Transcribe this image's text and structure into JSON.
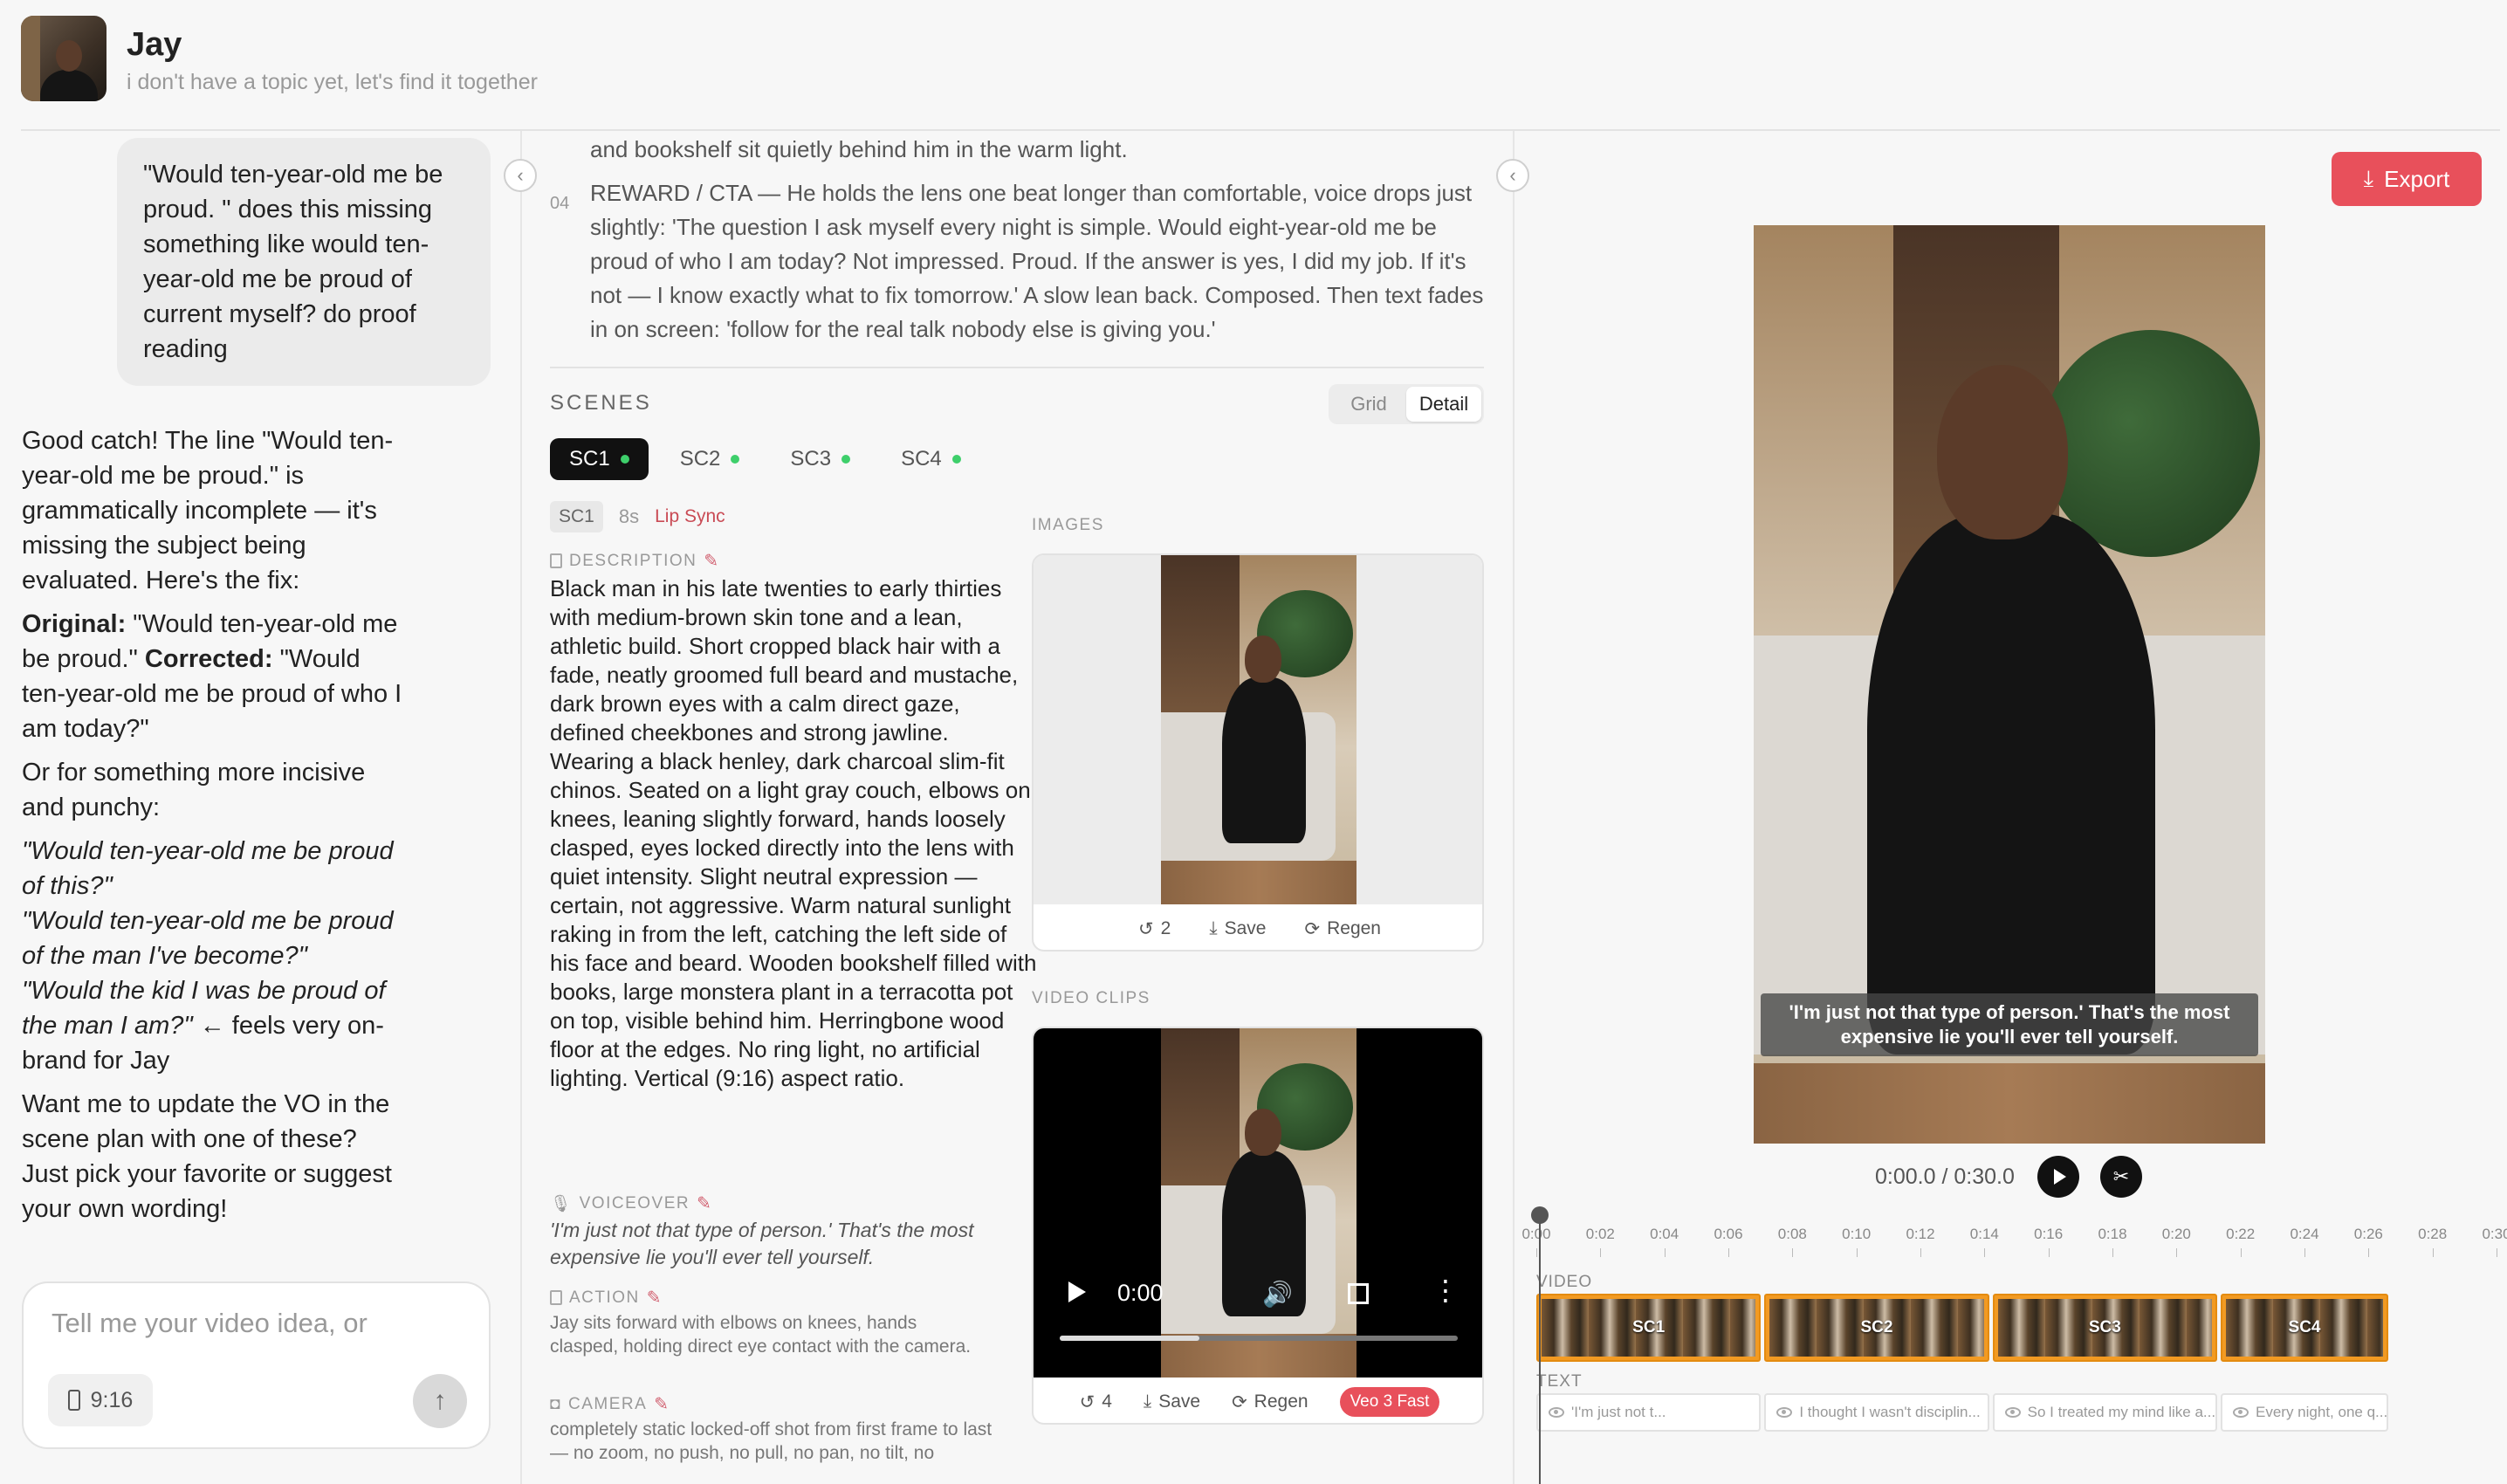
{
  "user": {
    "name": "Jay",
    "topic": "i don't have a topic yet, let's find it together"
  },
  "chat": {
    "user_message": "\"Would ten-year-old me be proud. \" does this missing something like would ten-year-old me be proud of current myself? do proof reading",
    "reply": {
      "p1": "Good catch! The line \"Would ten-year-old me be proud.\" is grammatically incomplete — it's missing the subject being evaluated. Here's the fix:",
      "original_label": "Original:",
      "original_text": " \"Would ten-year-old me be proud.\" ",
      "corrected_label": "Corrected:",
      "corrected_text": " \"Would ten-year-old me be proud of who I am today?\"",
      "p3": "Or for something more incisive and punchy:",
      "opt1": "\"Would ten-year-old me be proud of this?\"",
      "opt2": "\"Would ten-year-old me be proud of the man I've become?\"",
      "opt3_italic": "\"Would the kid I was be proud of the man I am?\"",
      "opt3_note": " ← feels very on-brand for Jay",
      "p5": "Want me to update the VO in the scene plan with one of these? Just pick your favorite or suggest your own wording!"
    },
    "composer": {
      "placeholder": "Tell me your video idea, or",
      "ratio": "9:16"
    }
  },
  "script": {
    "prev_line": "and bookshelf sit quietly behind him in the warm light.",
    "beat_num": "04",
    "beat_text": "REWARD / CTA — He holds the lens one beat longer than comfortable, voice drops just slightly: 'The question I ask myself every night is simple. Would eight-year-old me be proud of who I am today? Not impressed. Proud. If the answer is yes, I did my job. If it's not — I know exactly what to fix tomorrow.' A slow lean back. Composed. Then text fades in on screen: 'follow for the real talk nobody else is giving you.'"
  },
  "scenes": {
    "label": "SCENES",
    "view_grid": "Grid",
    "view_detail": "Detail",
    "tabs": [
      "SC1",
      "SC2",
      "SC3",
      "SC4"
    ],
    "active": {
      "id": "SC1",
      "duration": "8s",
      "mode": "Lip Sync",
      "description_label": "DESCRIPTION",
      "description": "Black man in his late twenties to early thirties with medium-brown skin tone and a lean, athletic build. Short cropped black hair with a fade, neatly groomed full beard and mustache, dark brown eyes with a calm direct gaze, defined cheekbones and strong jawline. Wearing a black henley, dark charcoal slim-fit chinos. Seated on a light gray couch, elbows on knees, leaning slightly forward, hands loosely clasped, eyes locked directly into the lens with quiet intensity. Slight neutral expression — certain, not aggressive. Warm natural sunlight raking in from the left, catching the left side of his face and beard. Wooden bookshelf filled with books, large monstera plant in a terracotta pot on top, visible behind him. Herringbone wood floor at the edges. No ring light, no artificial lighting. Vertical (9:16) aspect ratio.",
      "voiceover_label": "VOICEOVER",
      "voiceover": "'I'm just not that type of person.' That's the most expensive lie you'll ever tell yourself.",
      "action_label": "ACTION",
      "action": "Jay sits forward with elbows on knees, hands clasped, holding direct eye contact with the camera.",
      "camera_label": "CAMERA",
      "camera": "completely static locked-off shot from first frame to last — no zoom, no push, no pull, no pan, no tilt, no"
    },
    "images": {
      "label": "IMAGES",
      "history_count": "2",
      "save": "Save",
      "regen": "Regen"
    },
    "clips": {
      "label": "VIDEO CLIPS",
      "time": "0:00",
      "progress": 0.35,
      "history_count": "4",
      "save": "Save",
      "regen": "Regen",
      "model": "Veo 3 Fast"
    }
  },
  "preview": {
    "export": "Export",
    "subtitle": "'I'm just not that type of person.' That's the most expensive lie you'll ever tell yourself.",
    "time": "0:00.0 / 0:30.0"
  },
  "timeline": {
    "ticks": [
      "0:00",
      "0:02",
      "0:04",
      "0:06",
      "0:08",
      "0:10",
      "0:12",
      "0:14",
      "0:16",
      "0:18",
      "0:20",
      "0:22",
      "0:24",
      "0:26",
      "0:28",
      "0:30"
    ],
    "video_label": "VIDEO",
    "text_label": "TEXT",
    "video_clips": [
      {
        "label": "SC1",
        "start": 0,
        "end": 8
      },
      {
        "label": "SC2",
        "start": 8,
        "end": 16
      },
      {
        "label": "SC3",
        "start": 16,
        "end": 24
      },
      {
        "label": "SC4",
        "start": 24,
        "end": 30
      }
    ],
    "text_clips": [
      {
        "label": "'I'm just not t...",
        "start": 0,
        "end": 8
      },
      {
        "label": "I thought I wasn't disciplin...",
        "start": 8,
        "end": 16
      },
      {
        "label": "So I treated my mind like a...",
        "start": 16,
        "end": 24
      },
      {
        "label": "Every night, one q...",
        "start": 24,
        "end": 30
      }
    ],
    "duration": 30
  },
  "colors": {
    "accent": "#e8505b",
    "status_dot": "#3ecf6b",
    "clip_orange": "#f29a22"
  }
}
